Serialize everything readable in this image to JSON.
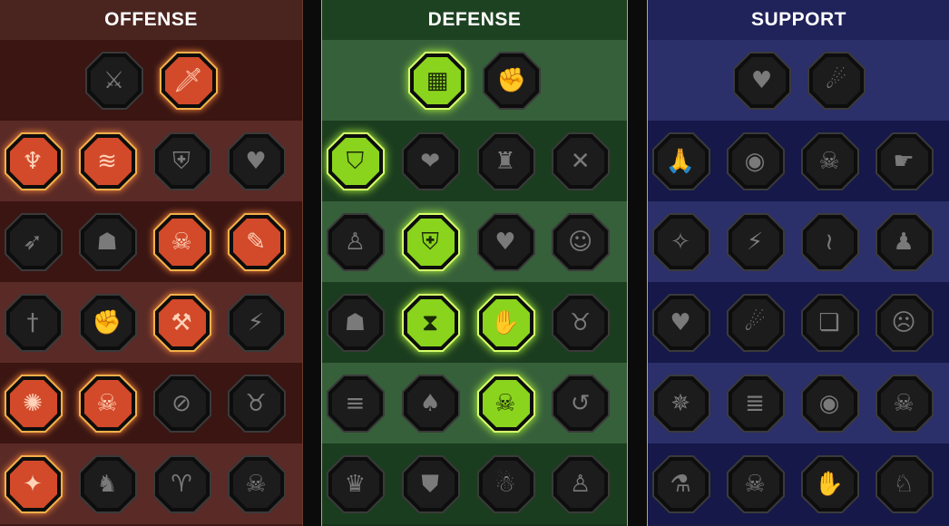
{
  "columns": [
    {
      "id": "offense",
      "title": "OFFENSE",
      "rows": [
        [
          {
            "icon": "crossed-swords-icon",
            "glyph": "⚔",
            "active": false
          },
          {
            "icon": "dagger-strike-icon",
            "glyph": "🗡",
            "active": true
          }
        ],
        [
          {
            "icon": "demon-icon",
            "glyph": "♆",
            "active": true
          },
          {
            "icon": "claw-slash-icon",
            "glyph": "≋",
            "active": true
          },
          {
            "icon": "shield-arrow-icon",
            "glyph": "⛨",
            "active": false
          },
          {
            "icon": "spiked-heart-icon",
            "glyph": "♥",
            "active": false
          }
        ],
        [
          {
            "icon": "archer-icon",
            "glyph": "➶",
            "active": false
          },
          {
            "icon": "fanged-mouth-icon",
            "glyph": "☗",
            "active": false
          },
          {
            "icon": "skull-slash-icon",
            "glyph": "☠",
            "active": true
          },
          {
            "icon": "knife-hand-icon",
            "glyph": "✎",
            "active": true
          }
        ],
        [
          {
            "icon": "sword-down-icon",
            "glyph": "†",
            "active": false
          },
          {
            "icon": "fist-hammer-icon",
            "glyph": "✊",
            "active": false
          },
          {
            "icon": "axe-icon",
            "glyph": "⚒",
            "active": true
          },
          {
            "icon": "chain-lightning-icon",
            "glyph": "⚡",
            "active": false
          }
        ],
        [
          {
            "icon": "flame-burst-icon",
            "glyph": "✺",
            "active": true
          },
          {
            "icon": "triple-skull-icon",
            "glyph": "☠",
            "active": true
          },
          {
            "icon": "blade-circle-icon",
            "glyph": "⊘",
            "active": false
          },
          {
            "icon": "brute-icon",
            "glyph": "♉",
            "active": false
          }
        ],
        [
          {
            "icon": "sparkle-sword-icon",
            "glyph": "✦",
            "active": true
          },
          {
            "icon": "knight-helm-icon",
            "glyph": "♞",
            "active": false
          },
          {
            "icon": "horned-beast-icon",
            "glyph": "♈",
            "active": false
          },
          {
            "icon": "burst-skull-icon",
            "glyph": "☠",
            "active": false
          }
        ]
      ]
    },
    {
      "id": "defense",
      "title": "DEFENSE",
      "rows": [
        [
          {
            "icon": "armor-plates-icon",
            "glyph": "▦",
            "active": true
          },
          {
            "icon": "raised-fist-icon",
            "glyph": "✊",
            "active": false
          }
        ],
        [
          {
            "icon": "chevron-shield-icon",
            "glyph": "⛉",
            "active": true
          },
          {
            "icon": "anatomical-heart-icon",
            "glyph": "❤",
            "active": false
          },
          {
            "icon": "stone-golem-icon",
            "glyph": "♜",
            "active": false
          },
          {
            "icon": "crossed-blades-icon",
            "glyph": "✕",
            "active": false
          }
        ],
        [
          {
            "icon": "warrior-spin-icon",
            "glyph": "♙",
            "active": false
          },
          {
            "icon": "knight-shield-icon",
            "glyph": "⛨",
            "active": true
          },
          {
            "icon": "heart-icon",
            "glyph": "♥",
            "active": false
          },
          {
            "icon": "hooded-figure-icon",
            "glyph": "☺",
            "active": false
          }
        ],
        [
          {
            "icon": "crowd-icon",
            "glyph": "☗",
            "active": false
          },
          {
            "icon": "hourglass-sun-icon",
            "glyph": "⧗",
            "active": true
          },
          {
            "icon": "hand-flame-icon",
            "glyph": "✋",
            "active": true
          },
          {
            "icon": "bull-head-icon",
            "glyph": "♉",
            "active": false
          }
        ],
        [
          {
            "icon": "dash-runner-icon",
            "glyph": "≡",
            "active": false
          },
          {
            "icon": "triple-drops-icon",
            "glyph": "♠",
            "active": false
          },
          {
            "icon": "radiant-skull-icon",
            "glyph": "☠",
            "active": true
          },
          {
            "icon": "swirl-icon",
            "glyph": "↺",
            "active": false
          }
        ],
        [
          {
            "icon": "spiky-demon-icon",
            "glyph": "♛",
            "active": false
          },
          {
            "icon": "winged-shield-icon",
            "glyph": "⛊",
            "active": false
          },
          {
            "icon": "bearded-elder-icon",
            "glyph": "☃",
            "active": false
          },
          {
            "icon": "strongman-icon",
            "glyph": "♙",
            "active": false
          }
        ]
      ]
    },
    {
      "id": "support",
      "title": "SUPPORT",
      "rows": [
        [
          {
            "icon": "heart-plus-icon",
            "glyph": "♥",
            "active": false
          },
          {
            "icon": "hand-swirl-icon",
            "glyph": "☄",
            "active": false
          }
        ],
        [
          {
            "icon": "praying-hands-icon",
            "glyph": "🙏",
            "active": false
          },
          {
            "icon": "ripple-shield-icon",
            "glyph": "◉",
            "active": false
          },
          {
            "icon": "smoke-skull-icon",
            "glyph": "☠",
            "active": false
          },
          {
            "icon": "hand-beam-icon",
            "glyph": "☛",
            "active": false
          }
        ],
        [
          {
            "icon": "sparkle-figure-icon",
            "glyph": "✧",
            "active": false
          },
          {
            "icon": "lightning-brackets-icon",
            "glyph": "⚡",
            "active": false
          },
          {
            "icon": "crack-icon",
            "glyph": "≀",
            "active": false
          },
          {
            "icon": "shadow-figures-icon",
            "glyph": "♟",
            "active": false
          }
        ],
        [
          {
            "icon": "chained-heart-icon",
            "glyph": "♥",
            "active": false
          },
          {
            "icon": "comet-icon",
            "glyph": "☄",
            "active": false
          },
          {
            "icon": "open-book-icon",
            "glyph": "❏",
            "active": false
          },
          {
            "icon": "angry-face-icon",
            "glyph": "☹",
            "active": false
          }
        ],
        [
          {
            "icon": "compass-star-icon",
            "glyph": "✵",
            "active": false
          },
          {
            "icon": "speed-boot-icon",
            "glyph": "≣",
            "active": false
          },
          {
            "icon": "eye-icon",
            "glyph": "◉",
            "active": false
          },
          {
            "icon": "bone-skull-icon",
            "glyph": "☠",
            "active": false
          }
        ],
        [
          {
            "icon": "poison-flask-icon",
            "glyph": "⚗",
            "active": false
          },
          {
            "icon": "horned-skull-icon",
            "glyph": "☠",
            "active": false
          },
          {
            "icon": "caged-hand-icon",
            "glyph": "✋",
            "active": false
          },
          {
            "icon": "eagle-head-icon",
            "glyph": "♘",
            "active": false
          }
        ]
      ]
    }
  ],
  "colors": {
    "offense_active_fill": "#d24a2a",
    "offense_active_border": "#f2b04a",
    "defense_active_fill": "#8ad41e",
    "defense_active_border": "#d6ff6a",
    "inactive_fill": "#1c1c1c",
    "inactive_border": "#3a3a3a"
  }
}
